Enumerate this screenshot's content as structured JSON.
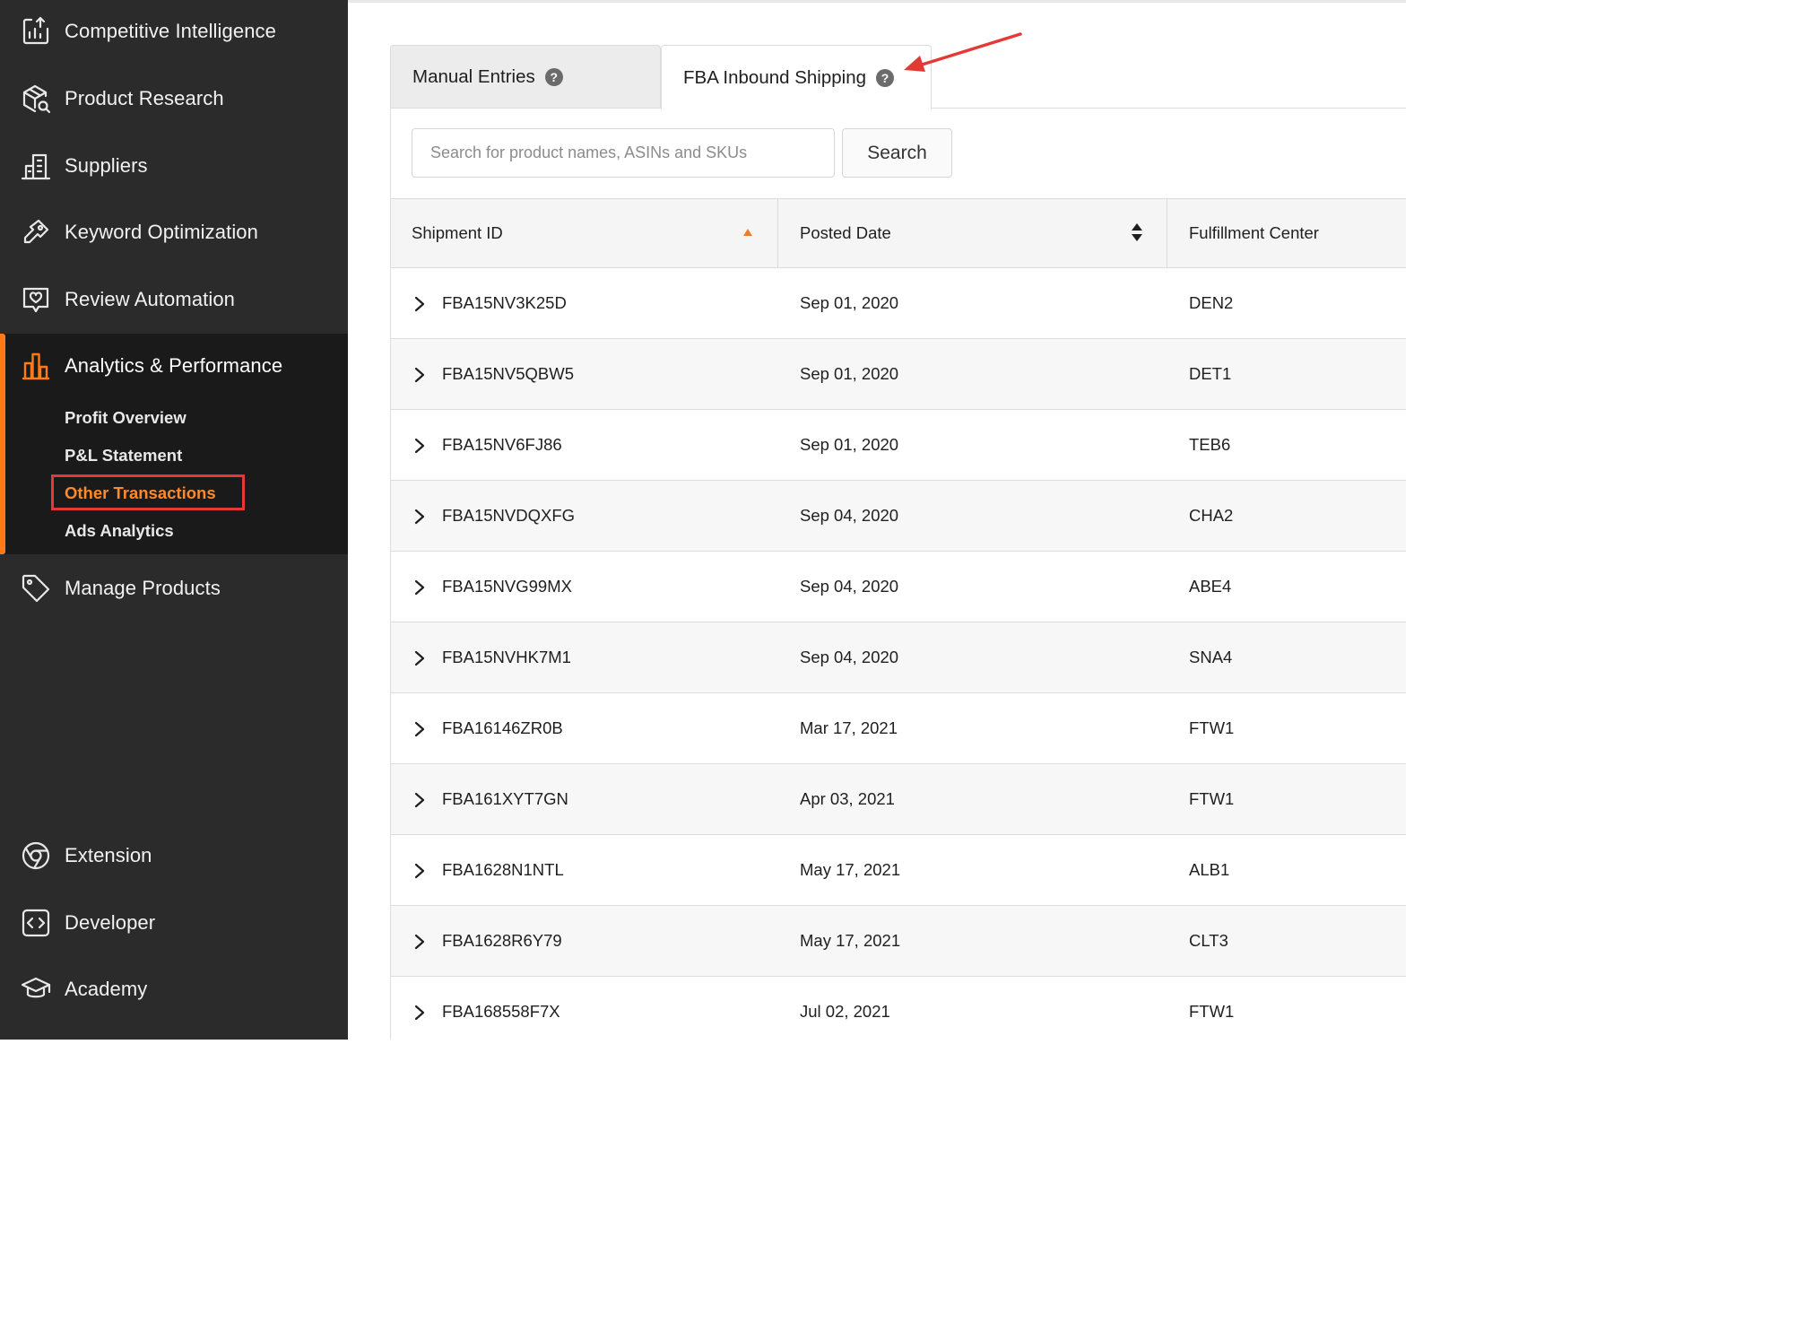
{
  "sidebar": {
    "items": [
      {
        "label": "Competitive Intelligence",
        "icon": "chart-upload-icon"
      },
      {
        "label": "Product Research",
        "icon": "box-search-icon"
      },
      {
        "label": "Suppliers",
        "icon": "building-icon"
      },
      {
        "label": "Keyword Optimization",
        "icon": "key-icon"
      },
      {
        "label": "Review Automation",
        "icon": "heart-chat-icon"
      },
      {
        "label": "Analytics & Performance",
        "icon": "bar-chart-icon"
      },
      {
        "label": "Manage Products",
        "icon": "tag-icon"
      },
      {
        "label": "Extension",
        "icon": "chrome-icon"
      },
      {
        "label": "Developer",
        "icon": "code-icon"
      },
      {
        "label": "Academy",
        "icon": "graduation-cap-icon"
      }
    ],
    "active_index": 5,
    "sub_items": [
      "Profit Overview",
      "P&L Statement",
      "Other Transactions",
      "Ads Analytics"
    ],
    "current_sub_item": "Other Transactions",
    "accent_color": "#ff7a1a"
  },
  "tabs": [
    {
      "label": "Manual Entries",
      "help": "?"
    },
    {
      "label": "FBA Inbound Shipping",
      "help": "?"
    }
  ],
  "active_tab": "FBA Inbound Shipping",
  "search": {
    "placeholder": "Search for product names, ASINs and SKUs",
    "value": "",
    "button_label": "Search"
  },
  "table": {
    "columns": [
      "Shipment ID",
      "Posted Date",
      "Fulfillment Center"
    ],
    "sort": {
      "column": "Shipment ID",
      "direction": "ascending"
    },
    "rows": [
      [
        "FBA15NV3K25D",
        "Sep 01, 2020",
        "DEN2"
      ],
      [
        "FBA15NV5QBW5",
        "Sep 01, 2020",
        "DET1"
      ],
      [
        "FBA15NV6FJ86",
        "Sep 01, 2020",
        "TEB6"
      ],
      [
        "FBA15NVDQXFG",
        "Sep 04, 2020",
        "CHA2"
      ],
      [
        "FBA15NVG99MX",
        "Sep 04, 2020",
        "ABE4"
      ],
      [
        "FBA15NVHK7M1",
        "Sep 04, 2020",
        "SNA4"
      ],
      [
        "FBA16146ZR0B",
        "Mar 17, 2021",
        "FTW1"
      ],
      [
        "FBA161XYT7GN",
        "Apr 03, 2021",
        "FTW1"
      ],
      [
        "FBA1628N1NTL",
        "May 17, 2021",
        "ALB1"
      ],
      [
        "FBA1628R6Y79",
        "May 17, 2021",
        "CLT3"
      ],
      [
        "FBA168558F7X",
        "Jul 02, 2021",
        "FTW1"
      ]
    ]
  },
  "annotation_colors": {
    "highlight_box": "#e53935",
    "arrow": "#e53935"
  }
}
